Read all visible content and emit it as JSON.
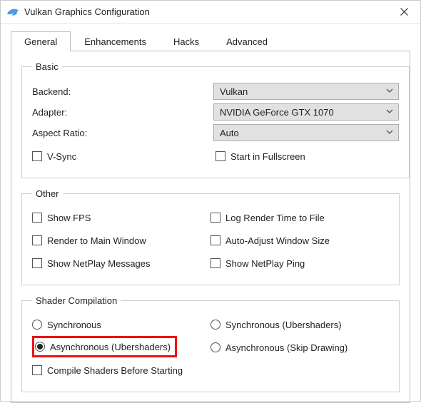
{
  "window": {
    "title": "Vulkan Graphics Configuration"
  },
  "tabs": {
    "items": [
      {
        "label": "General",
        "active": true
      },
      {
        "label": "Enhancements",
        "active": false
      },
      {
        "label": "Hacks",
        "active": false
      },
      {
        "label": "Advanced",
        "active": false
      }
    ]
  },
  "basic": {
    "legend": "Basic",
    "backend_label": "Backend:",
    "backend_value": "Vulkan",
    "adapter_label": "Adapter:",
    "adapter_value": "NVIDIA GeForce GTX 1070",
    "aspect_label": "Aspect Ratio:",
    "aspect_value": "Auto",
    "vsync_label": "V-Sync",
    "fullscreen_label": "Start in Fullscreen"
  },
  "other": {
    "legend": "Other",
    "show_fps": "Show FPS",
    "log_render": "Log Render Time to File",
    "render_main": "Render to Main Window",
    "auto_adjust": "Auto-Adjust Window Size",
    "netplay_msgs": "Show NetPlay Messages",
    "netplay_ping": "Show NetPlay Ping"
  },
  "shader": {
    "legend": "Shader Compilation",
    "sync": "Synchronous",
    "sync_uber": "Synchronous (Ubershaders)",
    "async_uber": "Asynchronous (Ubershaders)",
    "async_skip": "Asynchronous (Skip Drawing)",
    "compile_before": "Compile Shaders Before Starting"
  }
}
